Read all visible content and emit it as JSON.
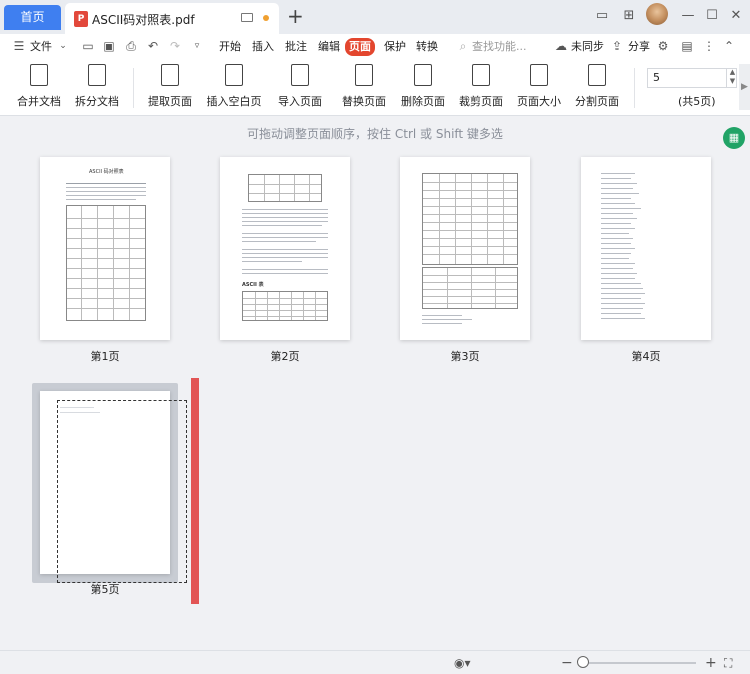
{
  "tabs": {
    "home": "首页",
    "document": "ASCII码对照表.pdf",
    "doc_type_badge": "P"
  },
  "menu": {
    "file": "文件",
    "items": [
      "开始",
      "插入",
      "批注",
      "编辑",
      "页面",
      "保护",
      "转换"
    ],
    "active": "页面",
    "search_placeholder": "查找功能...",
    "sync": "未同步",
    "share": "分享"
  },
  "toolbar": {
    "tools": [
      "合并文档",
      "拆分文档",
      "提取页面",
      "插入空白页",
      "导入页面",
      "替换页面",
      "删除页面",
      "裁剪页面",
      "页面大小",
      "分割页面"
    ],
    "page_input": "5",
    "page_total": "(共5页)"
  },
  "workspace": {
    "hint": "可拖动调整页面顺序，按住 Ctrl 或 Shift 键多选",
    "page_labels": [
      "第1页",
      "第2页",
      "第3页",
      "第4页",
      "第5页"
    ],
    "page1_title": "ASCII 码对照表",
    "page2_heading": "ASCII 表"
  },
  "icons": {
    "accent": "#3f7ff0",
    "active_menu": "#e3462e",
    "drop_indicator": "#e25555",
    "excel": "#21a366"
  }
}
